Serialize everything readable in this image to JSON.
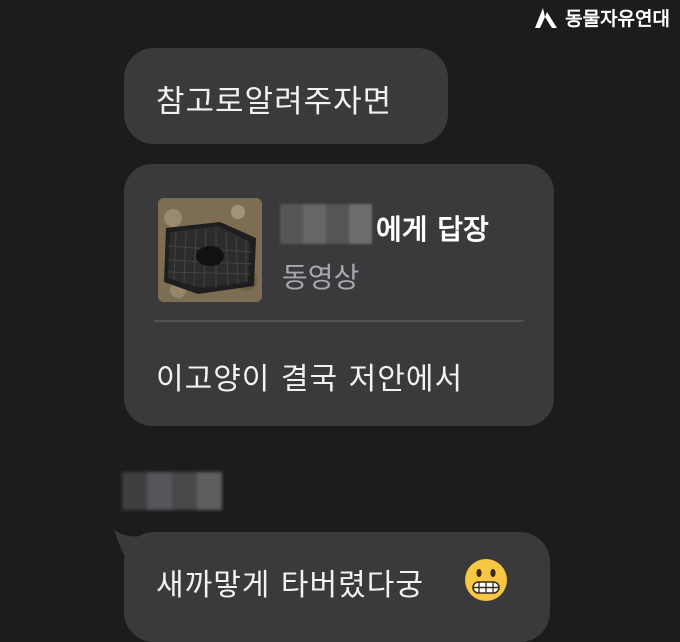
{
  "watermark": {
    "text": "동물자유연대"
  },
  "messages": {
    "m1": "참고로알려주자면",
    "reply": {
      "target_suffix": "에게 답장",
      "attachment_type": "동영상",
      "text": "이고양이 결국 저안에서"
    },
    "m3": "새까맣게 타버렸다궁"
  },
  "colors": {
    "background": "#1c1c1e",
    "bubble": "#3a3a3c",
    "text": "#f2f2f2",
    "muted": "#a8a8ac"
  },
  "icons": {
    "emoji": "grimacing-face-emoji",
    "logo": "organization-logo-icon"
  }
}
